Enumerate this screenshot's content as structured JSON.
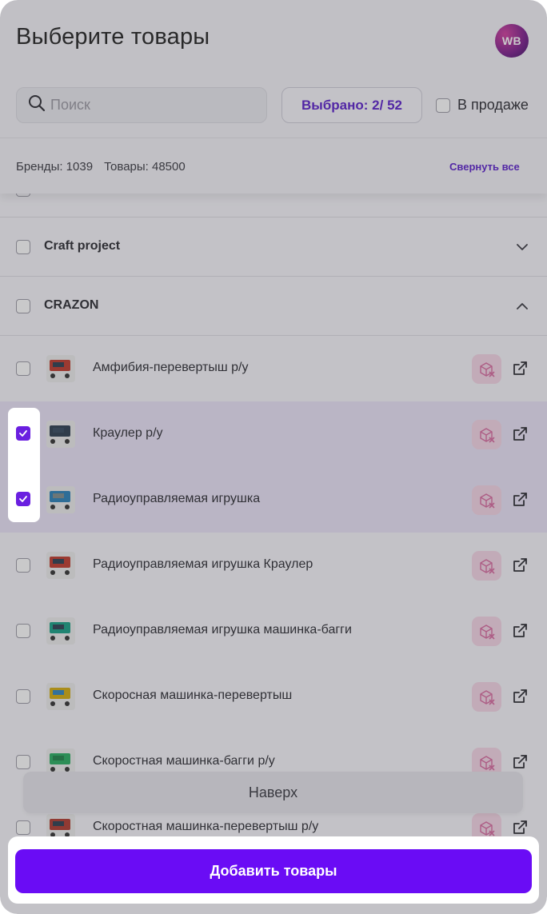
{
  "header": {
    "title": "Выберите товары",
    "avatar_text": "WB",
    "search_placeholder": "Поиск",
    "selected_label": "Выбрано: 2/ 52",
    "on_sale_label": "В продаже",
    "brands_stat": "Бренды: 1039",
    "products_stat": "Товары: 48500",
    "collapse_all": "Свернуть все"
  },
  "brands": [
    {
      "name": "Craft project",
      "expanded": false
    },
    {
      "name": "CRAZON",
      "expanded": true
    }
  ],
  "items": [
    {
      "name": "Амфибия-перевертыш р/у",
      "checked": false
    },
    {
      "name": "Краулер р/у",
      "checked": true
    },
    {
      "name": "Радиоуправляемая игрушка",
      "checked": true
    },
    {
      "name": "Радиоуправляемая игрушка Краулер",
      "checked": false
    },
    {
      "name": "Радиоуправляемая игрушка машинка-багги",
      "checked": false
    },
    {
      "name": "Скоросная машинка-перевертыш",
      "checked": false
    },
    {
      "name": "Скоростная машинка-багги р/у",
      "checked": false
    },
    {
      "name": "Скоростная машинка-перевертыш р/у",
      "checked": false
    }
  ],
  "to_top_label": "Наверх",
  "add_button_label": "Добавить товары",
  "colors": {
    "accent": "#6a0cf5",
    "accent_text": "#5b1fcc"
  }
}
